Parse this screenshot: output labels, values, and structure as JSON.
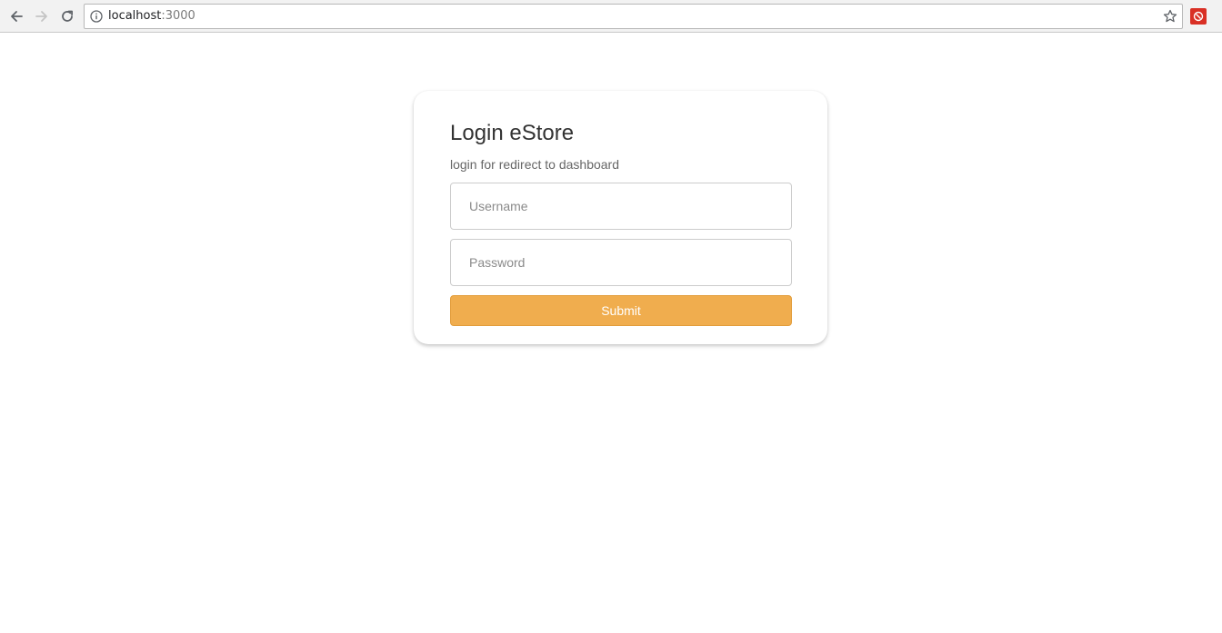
{
  "browser": {
    "url_host": "localhost",
    "url_port": ":3000",
    "icons": {
      "back": "back-arrow-icon",
      "forward": "forward-arrow-icon",
      "reload": "reload-icon",
      "info": "info-icon",
      "bookmark": "star-icon",
      "extension": "extension-icon"
    }
  },
  "login": {
    "title": "Login eStore",
    "subtitle": "login for redirect to dashboard",
    "username_placeholder": "Username",
    "username_value": "",
    "password_placeholder": "Password",
    "password_value": "",
    "submit_label": "Submit"
  },
  "colors": {
    "accent": "#f0ad4e",
    "accent_border": "#e29d3b",
    "title_text": "#333333",
    "subtitle_text": "#666666",
    "input_border": "#cccccc"
  }
}
